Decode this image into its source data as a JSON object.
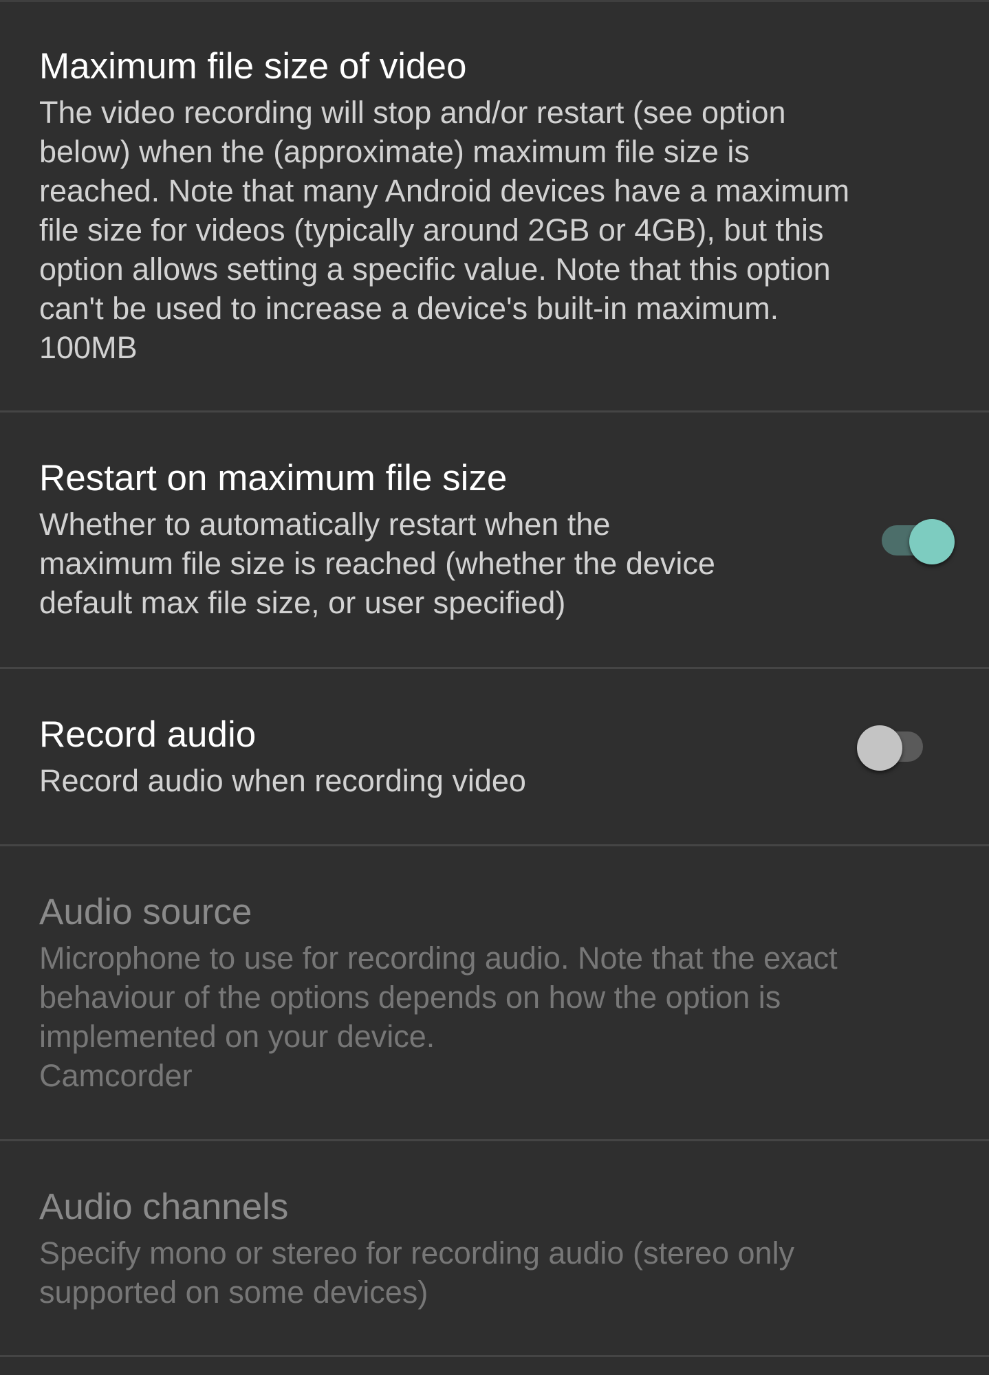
{
  "preferences": [
    {
      "title": "Maximum file size of video",
      "summary": "The video recording will stop and/or restart (see option\nbelow) when the (approximate) maximum file size is\nreached. Note that many Android devices have a maximum\nfile size for videos (typically around 2GB or 4GB), but this\noption allows setting a specific value. Note that this option\ncan't be used to increase a device's built-in maximum.",
      "value": "100MB",
      "enabled": true
    },
    {
      "title": "Restart on maximum file size",
      "summary": "Whether to automatically restart when the\nmaximum file size is reached (whether the device\ndefault max file size, or user specified)",
      "switch": "on",
      "enabled": true
    },
    {
      "title": "Record audio",
      "summary": "Record audio when recording video",
      "switch": "off",
      "enabled": true
    },
    {
      "title": "Audio source",
      "summary": "Microphone to use for recording audio. Note that the exact\nbehaviour of the options depends on how the option is\nimplemented on your device.",
      "value": "Camcorder",
      "enabled": false
    },
    {
      "title": "Audio channels",
      "summary": "Specify mono or stereo for recording audio (stereo only\nsupported on some devices)",
      "enabled": false
    }
  ],
  "colors": {
    "background": "#2f2f2f",
    "divider": "#454545",
    "title_text": "#ffffff",
    "summary_text": "#d2d2d2",
    "disabled_text": "#777777",
    "switch_on_thumb": "#7dccc0",
    "switch_on_track": "#4c6e6a",
    "switch_off_thumb": "#c4c4c4",
    "switch_off_track": "#5a5a5a"
  }
}
